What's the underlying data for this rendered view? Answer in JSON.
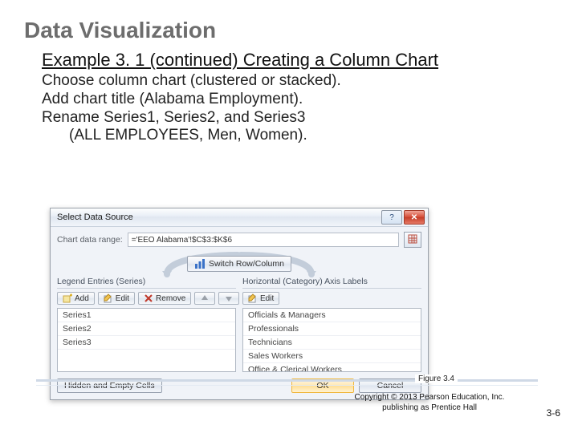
{
  "slide": {
    "title": "Data Visualization",
    "example_title": "Example 3. 1  (continued)  Creating a Column Chart",
    "instructions": {
      "line1": "Choose column chart (clustered or stacked).",
      "line2": "Add chart title (Alabama Employment).",
      "line3": "Rename Series1, Series2, and Series3",
      "line4": "(ALL EMPLOYEES, Men, Women)."
    },
    "figure_label": "Figure 3.4",
    "copyright_line1": "Copyright © 2013 Pearson Education, Inc.",
    "copyright_line2": "publishing as Prentice Hall",
    "page_number": "3-6"
  },
  "dialog": {
    "title": "Select Data Source",
    "data_range_label": "Chart data range:",
    "data_range_value": "='EEO Alabama'!$C$3:$K$6",
    "switch_label": "Switch Row/Column",
    "legend_header": "Legend Entries (Series)",
    "axis_header": "Horizontal (Category) Axis Labels",
    "buttons": {
      "add": "Add",
      "edit": "Edit",
      "remove": "Remove",
      "edit2": "Edit",
      "hidden": "Hidden and Empty Cells",
      "ok": "OK",
      "cancel": "Cancel"
    },
    "series": [
      "Series1",
      "Series2",
      "Series3"
    ],
    "categories": [
      "Officials & Managers",
      "Professionals",
      "Technicians",
      "Sales Workers",
      "Office & Clerical Workers"
    ]
  }
}
